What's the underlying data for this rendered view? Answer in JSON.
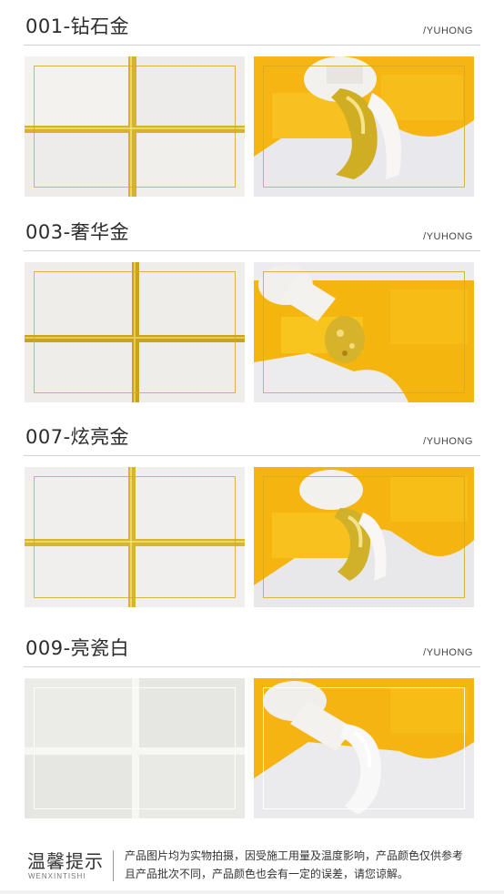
{
  "brand": "/YUHONG",
  "sections": [
    {
      "title": "001-钻石金",
      "color": "#d4b428"
    },
    {
      "title": "003-奢华金",
      "color": "#c9a21e"
    },
    {
      "title": "007-炫亮金",
      "color": "#d6b72b"
    },
    {
      "title": "009-亮瓷白",
      "color": "#f4f3ef"
    }
  ],
  "tips": {
    "title": "温馨提示",
    "subtitle": "WENXINTISHI",
    "line1": "产品图片均为实物拍摄，因受施工用量及温度影响，产品颜色仅供参考",
    "line2": "且产品批次不同，产品颜色也会有一定的误差，请您谅解。"
  }
}
